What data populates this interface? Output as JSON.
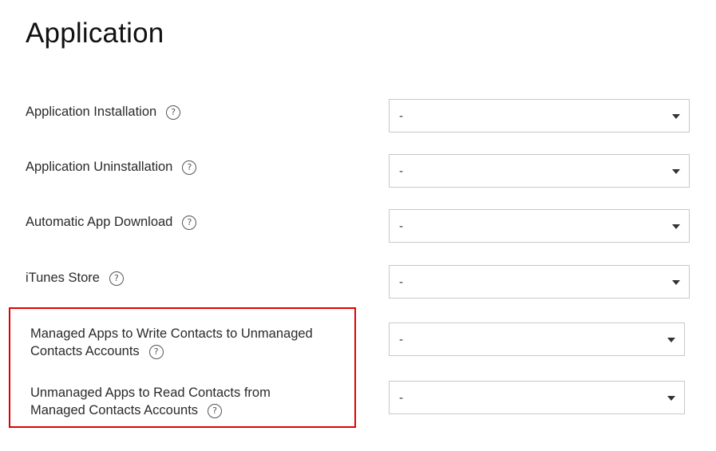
{
  "page": {
    "title": "Application"
  },
  "rows": [
    {
      "label": "Application Installation",
      "help": "?",
      "value": "-"
    },
    {
      "label": "Application Uninstallation",
      "help": "?",
      "value": "-"
    },
    {
      "label": "Automatic App Download",
      "help": "?",
      "value": "-"
    },
    {
      "label": "iTunes Store",
      "help": "?",
      "value": "-"
    }
  ],
  "highlighted_rows": [
    {
      "label_line1": "Managed Apps to Write Contacts to Unmanaged",
      "label_line2": "Contacts Accounts",
      "help": "?",
      "value": "-"
    },
    {
      "label_line1": "Unmanaged Apps to Read Contacts from",
      "label_line2": "Managed Contacts Accounts",
      "help": "?",
      "value": "-"
    }
  ],
  "colors": {
    "highlight_border": "#e00000",
    "select_border": "#c8c8c8"
  },
  "icons": {
    "help": "help-circle-icon",
    "dropdown": "caret-down-icon"
  }
}
